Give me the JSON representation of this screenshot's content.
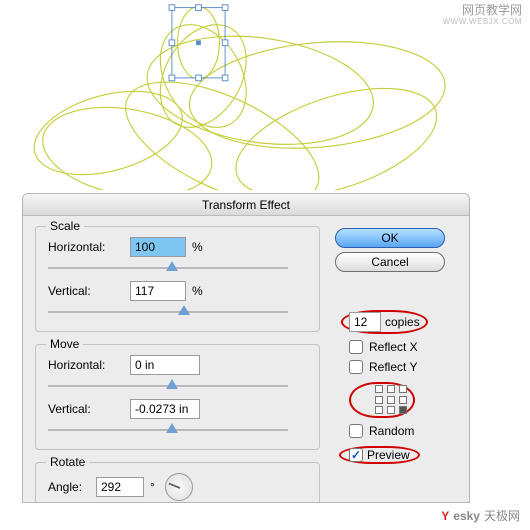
{
  "watermark_top": {
    "line1": "网页教学网",
    "line2": "WWW.WEBJX.COM"
  },
  "watermark_bottom": {
    "text": "esky",
    "domain": "天极网"
  },
  "dialog": {
    "title": "Transform Effect",
    "ok": "OK",
    "cancel": "Cancel",
    "scale": {
      "legend": "Scale",
      "h_label": "Horizontal:",
      "h_value": "100",
      "h_unit": "%",
      "v_label": "Vertical:",
      "v_value": "117",
      "v_unit": "%"
    },
    "move": {
      "legend": "Move",
      "h_label": "Horizontal:",
      "h_value": "0 in",
      "v_label": "Vertical:",
      "v_value": "-0.0273 in"
    },
    "rotate": {
      "legend": "Rotate",
      "label": "Angle:",
      "value": "292",
      "unit": "°"
    },
    "copies_value": "12",
    "copies_label": "copies",
    "reflect_x": "Reflect X",
    "reflect_y": "Reflect Y",
    "random": "Random",
    "preview": "Preview",
    "preview_checked": true
  }
}
